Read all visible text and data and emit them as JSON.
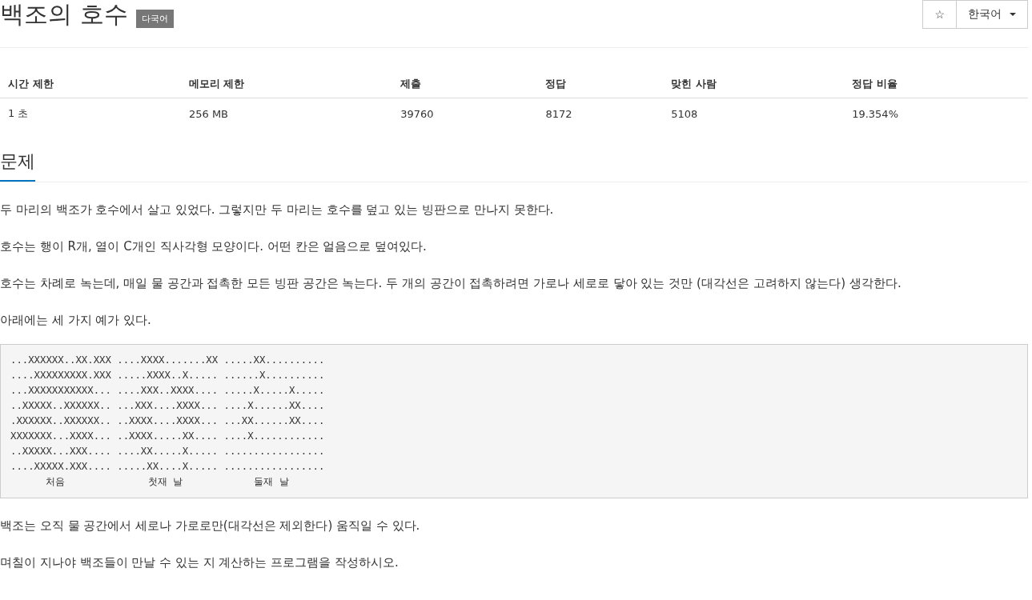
{
  "title": "백조의 호수",
  "badge": "다국어",
  "star_button": "☆",
  "language_button": {
    "label": "한국어"
  },
  "stats": {
    "columns": [
      "시간 제한",
      "메모리 제한",
      "제출",
      "정답",
      "맞힌 사람",
      "정답 비율"
    ],
    "values": [
      "1 초",
      "256 MB",
      "39760",
      "8172",
      "5108",
      "19.354%"
    ]
  },
  "section_title": "문제",
  "paragraphs_before": [
    "두 마리의 백조가 호수에서 살고 있었다. 그렇지만 두 마리는 호수를 덮고 있는 빙판으로 만나지 못한다.",
    "호수는 행이 R개, 열이 C개인 직사각형 모양이다. 어떤 칸은 얼음으로 덮여있다.",
    "호수는 차례로 녹는데, 매일 물 공간과 접촉한 모든 빙판 공간은 녹는다. 두 개의 공간이 접촉하려면 가로나 세로로 닿아 있는 것만 (대각선은 고려하지 않는다) 생각한다.",
    "아래에는 세 가지 예가 있다."
  ],
  "example": "...XXXXXX..XX.XXX ....XXXX.......XX .....XX..........\n....XXXXXXXXX.XXX .....XXXX..X..... ......X..........\n...XXXXXXXXXXX... ....XXX..XXXX.... .....X.....X.....\n..XXXXX..XXXXXX.. ...XXX....XXXX... ....X......XX....\n.XXXXXX..XXXXXX.. ..XXXX....XXXX... ...XX......XX....\nXXXXXXX...XXXX... ..XXXX.....XX.... ....X............\n..XXXXX...XXX.... ....XX.....X..... .................\n....XXXXX.XXX.... .....XX....X..... .................\n      처음              첫재 날            둘재 날",
  "paragraphs_after": [
    "백조는 오직 물 공간에서 세로나 가로로만(대각선은 제외한다) 움직일 수 있다.",
    "며칠이 지나야 백조들이 만날 수 있는 지 계산하는 프로그램을 작성하시오."
  ]
}
